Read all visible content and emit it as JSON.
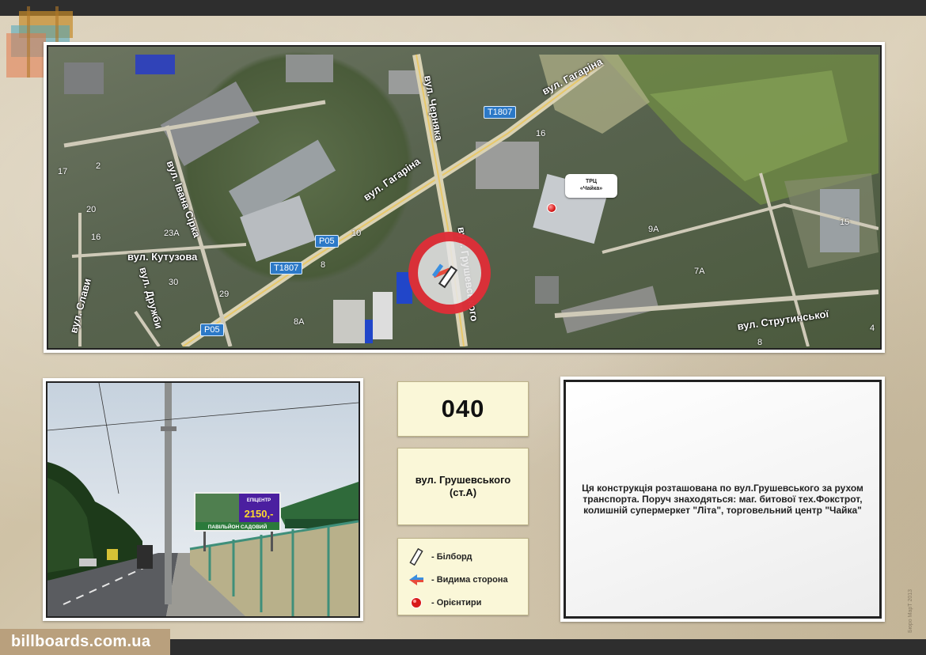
{
  "map": {
    "streets": {
      "gagarina_top": "вул. Гагаріна",
      "gagarina_mid": "вул. Гагаріна",
      "chernyaka": "вул. Черняка",
      "ivana_sirka": "вул. Івана Сірка",
      "kutuzova": "вул. Кутузова",
      "slavy": "вул. Слави",
      "druzhby": "вул. Дружби",
      "strutynskoi": "вул. Струтинської",
      "hrushevskoho": "вул. Грушевського"
    },
    "shields": {
      "t1807_top": "T1807",
      "t1807_mid": "T1807",
      "p05_mid": "P05",
      "p05_bottom": "P05"
    },
    "house_numbers": [
      "17",
      "2",
      "20",
      "16",
      "23A",
      "30",
      "29",
      "8A",
      "10",
      "8",
      "16",
      "9A",
      "7A",
      "15",
      "8",
      "4"
    ],
    "callout": {
      "line1": "ТРЦ",
      "line2": "«Чайка»"
    }
  },
  "photo": {
    "billboard": {
      "brand": "ЕПІЦЕНТР",
      "price": "2150,-",
      "title": "ПАВІЛЬЙОН САДОВИЙ"
    }
  },
  "info": {
    "code": "040",
    "address_line1": "вул. Грушевського",
    "address_line2": "(ст.А)",
    "description": "Ця конструкція розташована по вул.Грушевського за рухом транспорта. Поруч знаходяться: маг. битової тех.Фокстрот, колишній супермеркет \"Літа\", торговельний центр \"Чайка\""
  },
  "legend": [
    {
      "label": "- Білборд",
      "icon": "billboard-icon"
    },
    {
      "label": "- Видима сторона",
      "icon": "visible-side-arrow-icon"
    },
    {
      "label": "- Орієнтири",
      "icon": "landmark-dot-icon"
    }
  ],
  "footer": {
    "site": "billboards.com.ua",
    "copyright": "Бюро МарТ 2013"
  },
  "colors": {
    "marker_red": "#dc141e",
    "shield_blue": "#2c79c7",
    "info_box_bg": "#faf7d8",
    "badge_bg": "#b9a07d"
  }
}
